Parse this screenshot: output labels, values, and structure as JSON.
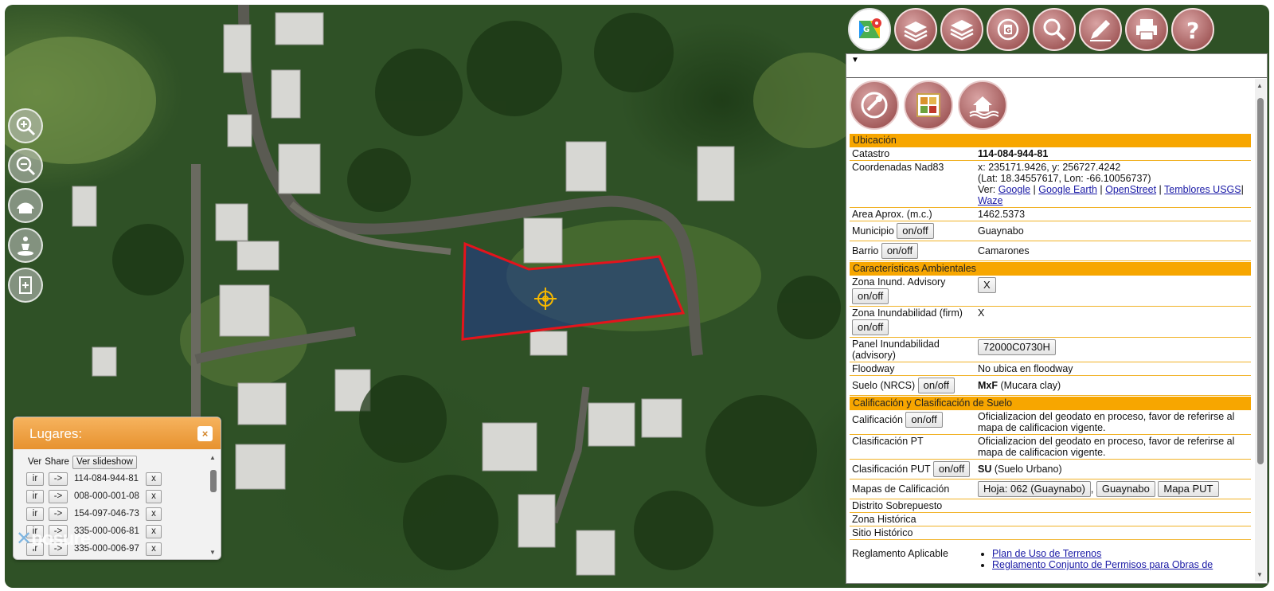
{
  "toolbar": {
    "buttons": [
      "google-maps-icon",
      "layers-icon",
      "base-layers-icon",
      "gis-icon",
      "search-icon",
      "draw-icon",
      "print-icon",
      "help-icon"
    ]
  },
  "map_tools": [
    "zoom-in-icon",
    "zoom-out-icon",
    "full-extent-icon",
    "street-view-icon",
    "add-location-icon"
  ],
  "panel": {
    "ubicacion": {
      "title": "Ubicación",
      "catastro_label": "Catastro",
      "catastro_value": "114-084-944-81",
      "coord_label": "Coordenadas Nad83",
      "coord_xy": "x: 235171.9426, y: 256727.4242",
      "coord_latlon": "(Lat: 18.34557617, Lon: -66.10056737)",
      "ver_label": "Ver:",
      "links": [
        "Google",
        "Google Earth",
        "OpenStreet",
        "Temblores USGS",
        "Waze"
      ],
      "area_label": "Area Aprox. (m.c.)",
      "area_value": "1462.5373",
      "municipio_label": "Municipio",
      "municipio_value": "Guaynabo",
      "barrio_label": "Barrio",
      "barrio_value": "Camarones",
      "onoff": "on/off"
    },
    "ambientales": {
      "title": "Características Ambientales",
      "zona_adv_label": "Zona Inund. Advisory",
      "zona_adv_value": "X",
      "zona_firm_label": "Zona Inundabilidad (firm)",
      "zona_firm_value": "X",
      "panel_label": "Panel Inundabilidad (advisory)",
      "panel_value": "72000C0730H",
      "floodway_label": "Floodway",
      "floodway_value": "No ubica en floodway",
      "suelo_label": "Suelo (NRCS)",
      "suelo_code": "MxF",
      "suelo_desc": " (Mucara clay)"
    },
    "calificacion": {
      "title": "Calificación y Clasificación de Suelo",
      "calif_label": "Calificación",
      "calif_value": "Oficializacion del geodato en proceso, favor de referirse al mapa de calificacion vigente.",
      "clas_pt_label": "Clasificación PT",
      "clas_pt_value": "Oficializacion del geodato en proceso, favor de referirse al mapa de calificacion vigente.",
      "clas_put_label": "Clasificación PUT",
      "clas_put_code": "SU",
      "clas_put_desc": " (Suelo Urbano)",
      "mapas_label": "Mapas de Calificación",
      "mapas_buttons": [
        "Hoja: 062 (Guaynabo)",
        "Guaynabo",
        "Mapa PUT"
      ],
      "distrito_label": "Distrito Sobrepuesto",
      "zona_hist_label": "Zona Histórica",
      "sitio_hist_label": "Sitio Histórico",
      "reglamento_label": "Reglamento Aplicable",
      "reglamentos": [
        "Plan de Uso de Terrenos",
        "Reglamento Conjunto de Permisos para Obras de"
      ]
    }
  },
  "lugares": {
    "title": "Lugares:",
    "close": "×",
    "col_ver": "Ver",
    "col_share": "Share",
    "slideshow": "Ver slideshow",
    "ir": "ir",
    "go": "->",
    "x": "x",
    "items": [
      "114-084-944-81",
      "008-000-001-08",
      "154-097-046-73",
      "335-000-006-81",
      "335-000-006-97"
    ]
  },
  "watermark": "posure",
  "colors": {
    "section": "#f7a600",
    "parcel_outline": "#e4141c",
    "button_red": "#a25a5a"
  }
}
